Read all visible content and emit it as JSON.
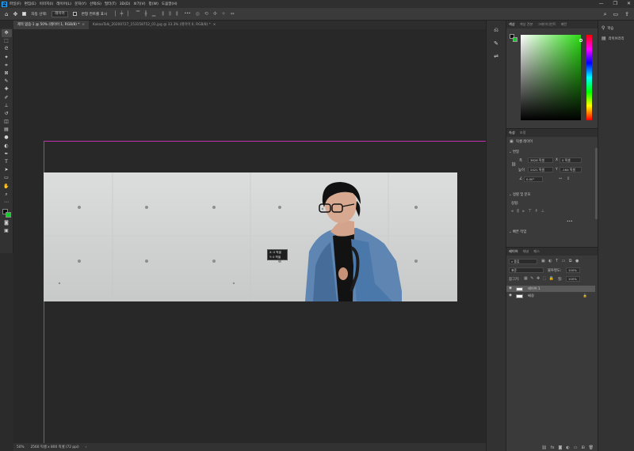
{
  "menubar": {
    "app_logo": "Ps",
    "items": [
      "파일(F)",
      "편집(E)",
      "이미지(I)",
      "레이어(L)",
      "문자(Y)",
      "선택(S)",
      "필터(T)",
      "3D(D)",
      "보기(V)",
      "창(W)",
      "도움말(H)"
    ],
    "window_controls": [
      "—",
      "❐",
      "✕"
    ]
  },
  "options_bar": {
    "auto_select_label": "자동 선택:",
    "auto_select_value": "레이어",
    "show_transform_label": "변형 컨트롤 표시",
    "more": "•••"
  },
  "document_tabs": [
    {
      "title": "제목 없음-1 @ 50% (레이어 1, RGB/8) *",
      "active": true
    },
    {
      "title": "KakaoTalk_20200727_153158752_01.jpg @ 33.3% (레이어 0, RGB/8) *",
      "active": false
    }
  ],
  "tooltip": {
    "line1": "X: 0 픽셀",
    "line2": "Y: 0 픽셀"
  },
  "status": {
    "zoom": "50%",
    "doc_info": "2560 픽셀 x 800 픽셀 (72 ppi)",
    "arrow": "›"
  },
  "color_panel": {
    "tabs": [
      "색상",
      "색상 견본",
      "그레이디언트",
      "패턴"
    ],
    "foreground": "#0b0b0b",
    "background": "#18c82c"
  },
  "properties_panel": {
    "tabs": [
      "속성",
      "조정"
    ],
    "layer_type": "픽셀 레이어",
    "transform_heading": "변형",
    "w_label": "폭",
    "w_value": "3626 픽셀",
    "x_label": "X",
    "x_value": "0 픽셀",
    "h_label": "높이",
    "h_value": "2421 픽셀",
    "y_label": "Y",
    "y_value": "-164 픽셀",
    "angle_value": "0.00°",
    "align_heading": "정렬 및 분포",
    "align_label": "정렬:",
    "quick_actions_heading": "빠른 작업",
    "more": "•••"
  },
  "layers_panel": {
    "tabs": [
      "레이어",
      "채널",
      "패스"
    ],
    "filter_type": "종류",
    "blend_mode": "표준",
    "opacity_label": "불투명도:",
    "opacity_value": "100%",
    "lock_label": "잠그기:",
    "fill_label": "칠:",
    "fill_value": "100%",
    "layers": [
      {
        "name": "레이어 1",
        "selected": true
      },
      {
        "name": "배경",
        "selected": false
      }
    ]
  },
  "far_right": {
    "learn_label": "학습",
    "libraries_label": "라이브러리"
  }
}
